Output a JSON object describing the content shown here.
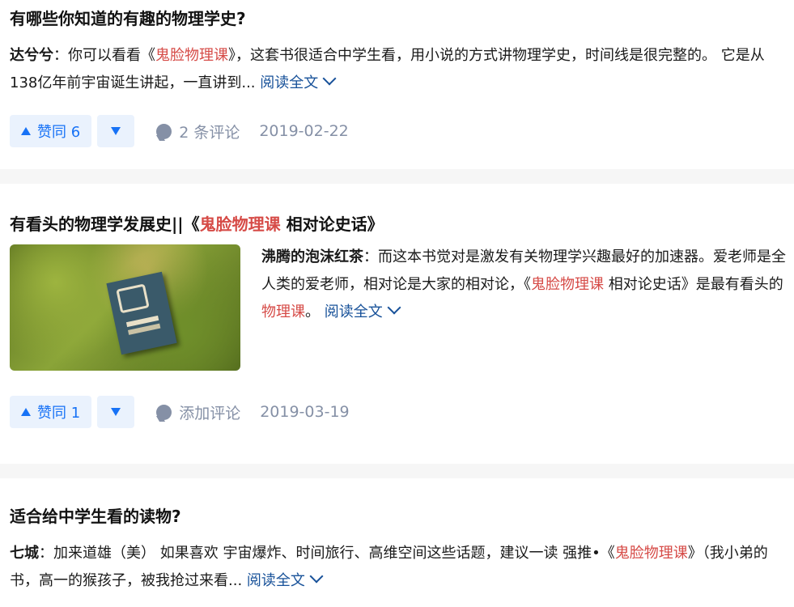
{
  "items": [
    {
      "title": "有哪些你知道的有趣的物理学史?",
      "author": "达兮兮",
      "sep": "：",
      "text_a": "你可以看看《",
      "highlight": "鬼脸物理课",
      "text_b": "》，这套书很适合中学生看，用小说的方式讲物理学史，时间线是很完整的。 它是从138亿年前宇宙诞生讲起，一直讲到... ",
      "read_more": "阅读全文",
      "votes_label": "赞同 6",
      "comments": "2 条评论",
      "date": "2019-02-22"
    },
    {
      "title_a": "有看头的物理学发展史||《",
      "title_hl": "鬼脸物理课",
      "title_b": " 相对论史话》",
      "author": "沸腾的泡沫红茶",
      "sep": "：",
      "text_a": "而这本书觉对是激发有关物理学兴趣最好的加速器。爱老师是全人类的爱老师，相对论是大家的相对论，《",
      "highlight": "鬼脸物理课",
      "text_b": " 相对论史话》是最有看头的",
      "highlight2": "物理课",
      "text_c": "。 ",
      "read_more": "阅读全文",
      "votes_label": "赞同 1",
      "comments": "添加评论",
      "date": "2019-03-19"
    },
    {
      "title": "适合给中学生看的读物?",
      "author": "七城",
      "sep": "：",
      "text_a": "加来道雄（美） 如果喜欢 宇宙爆炸、时间旅行、高维空间这些话题，建议一读 强推•《",
      "highlight": "鬼脸物理课",
      "text_b": "》（我小弟的书，高一的猴孩子，被我抢过来看... ",
      "read_more": "阅读全文"
    }
  ],
  "colors": {
    "highlight": "#d64b47",
    "link": "#175199",
    "vote": "#1772f6",
    "meta": "#8590a6"
  }
}
